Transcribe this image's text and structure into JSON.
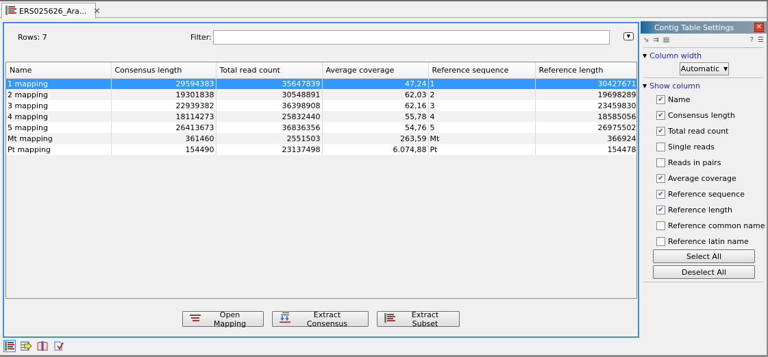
{
  "tab": {
    "label": "ERS025626_Ara...",
    "icon": "table-icon",
    "close_icon": "close-icon"
  },
  "toolbar": {
    "rows_label": "Rows: 7",
    "filter_label": "Filter:",
    "filter_value": "",
    "filter_menu_icon": "dropdown-menu-icon"
  },
  "table": {
    "columns": [
      "Name",
      "Consensus length",
      "Total read count",
      "Average coverage",
      "Reference sequence",
      "Reference length"
    ],
    "rows": [
      {
        "name": "1 mapping",
        "consensus_length": "29594383",
        "total_read_count": "35647839",
        "average_coverage": "47,24",
        "reference_sequence": "1",
        "reference_length": "30427671",
        "selected": true
      },
      {
        "name": "2 mapping",
        "consensus_length": "19301838",
        "total_read_count": "30548891",
        "average_coverage": "62,03",
        "reference_sequence": "2",
        "reference_length": "19698289",
        "selected": false
      },
      {
        "name": "3 mapping",
        "consensus_length": "22939382",
        "total_read_count": "36398908",
        "average_coverage": "62,16",
        "reference_sequence": "3",
        "reference_length": "23459830",
        "selected": false
      },
      {
        "name": "4 mapping",
        "consensus_length": "18114273",
        "total_read_count": "25832440",
        "average_coverage": "55,78",
        "reference_sequence": "4",
        "reference_length": "18585056",
        "selected": false
      },
      {
        "name": "5 mapping",
        "consensus_length": "26413673",
        "total_read_count": "36836356",
        "average_coverage": "54,76",
        "reference_sequence": "5",
        "reference_length": "26975502",
        "selected": false
      },
      {
        "name": "Mt mapping",
        "consensus_length": "361460",
        "total_read_count": "2551503",
        "average_coverage": "263,59",
        "reference_sequence": "Mt",
        "reference_length": "366924",
        "selected": false
      },
      {
        "name": "Pt mapping",
        "consensus_length": "154490",
        "total_read_count": "23137498",
        "average_coverage": "6.074,88",
        "reference_sequence": "Pt",
        "reference_length": "154478",
        "selected": false
      }
    ]
  },
  "actions": {
    "open_mapping": "Open Mapping",
    "extract_consensus": "Extract Consensus",
    "extract_subset": "Extract Subset"
  },
  "bottom_views": [
    "table-view-icon",
    "element-info-icon",
    "history-book-icon",
    "annotations-check-icon"
  ],
  "settings": {
    "title": "Contig Table Settings",
    "help_label": "?",
    "column_width": {
      "label": "Column width",
      "value": "Automatic"
    },
    "show_column": {
      "label": "Show column",
      "items": [
        {
          "label": "Name",
          "checked": true
        },
        {
          "label": "Consensus length",
          "checked": true
        },
        {
          "label": "Total read count",
          "checked": true
        },
        {
          "label": "Single reads",
          "checked": false
        },
        {
          "label": "Reads in pairs",
          "checked": false
        },
        {
          "label": "Average coverage",
          "checked": true
        },
        {
          "label": "Reference sequence",
          "checked": true
        },
        {
          "label": "Reference length",
          "checked": true
        },
        {
          "label": "Reference common name",
          "checked": false
        },
        {
          "label": "Reference latin name",
          "checked": false
        }
      ]
    },
    "select_all": "Select All",
    "deselect_all": "Deselect All"
  },
  "colors": {
    "accent": "#3a8ee6",
    "selection": "#3399ff",
    "section_link": "#1a1aff"
  }
}
